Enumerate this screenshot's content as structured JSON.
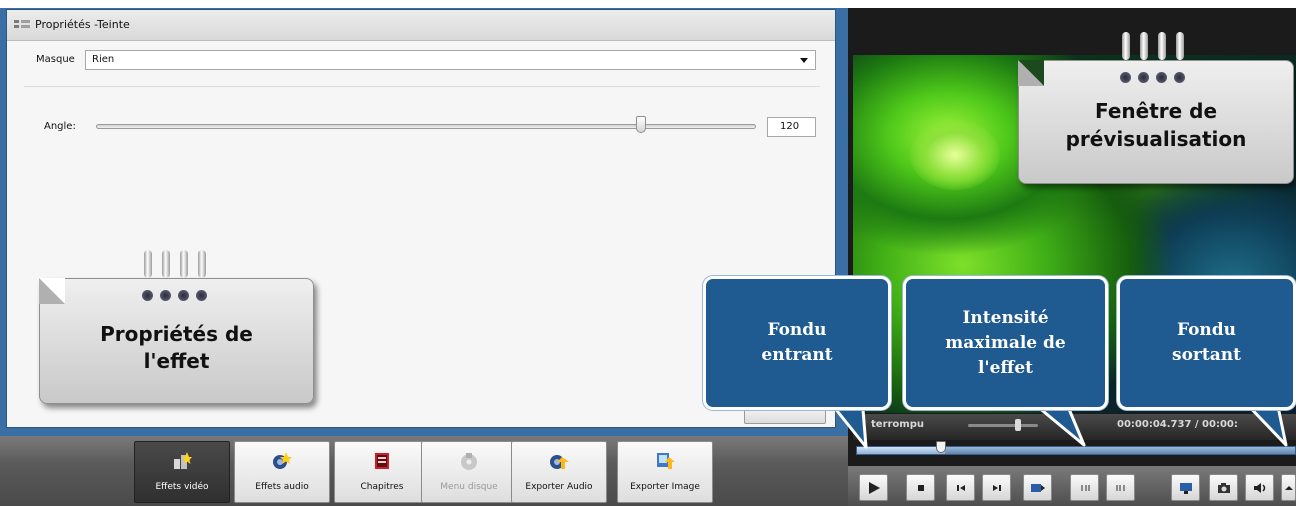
{
  "properties_panel": {
    "title": "Propriétés -Teinte",
    "masque": {
      "label": "Masque",
      "value": "Rien"
    },
    "angle": {
      "label": "Angle:",
      "value": "120",
      "slider_level": 0.83
    }
  },
  "toolbar": {
    "buttons": [
      {
        "label": "Effets vidéo"
      },
      {
        "label": "Effets audio"
      },
      {
        "label": "Chapitres"
      },
      {
        "label": "Menu disque"
      },
      {
        "label": "Exporter Audio"
      },
      {
        "label": "Exporter Image"
      }
    ]
  },
  "player": {
    "mode_label": "terrompu",
    "time_label": "00:00:04.737 / 00:00:",
    "timeline_progress": 0.2
  },
  "callouts": {
    "properties": "Propriétés de l'effet",
    "properties_line1": "Propriétés de",
    "properties_line2": "l'effet",
    "preview_line1": "Fenêtre de",
    "preview_line2": "prévisualisation",
    "fade_in_line1": "Fondu",
    "fade_in_line2": "entrant",
    "peak_line1": "Intensité",
    "peak_line2": "maximale de",
    "peak_line3": "l'effet",
    "fade_out_line1": "Fondu",
    "fade_out_line2": "sortant"
  },
  "colors": {
    "frame_blue": "#3a6fa5",
    "bubble_blue": "#1f5a90",
    "timeline_blue": "#5f86b3"
  }
}
